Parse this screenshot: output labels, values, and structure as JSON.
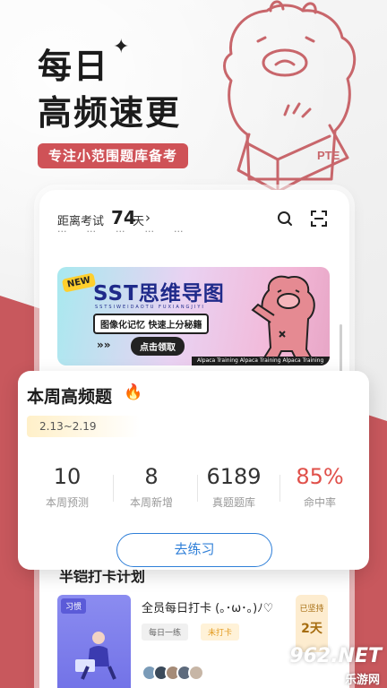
{
  "hero": {
    "line1": "每日",
    "line2": "高频速更",
    "tag": "专注小范围题库备考"
  },
  "mascot": {
    "book_label": "PTE"
  },
  "topbar": {
    "exam_label": "距离考试",
    "days": "74",
    "unit": "天",
    "chevron": "›"
  },
  "menu_strip": [
    "...",
    "...",
    "...",
    "...",
    "..."
  ],
  "banner": {
    "new": "NEW",
    "title": "SST思维导图",
    "pinyin": "SSTSIWEIDAOTU FUXIANGJIYI",
    "subtitle": "图像化记忆  快速上分秘籍",
    "cta": "点击领取",
    "ribbon": "Alpaca Training   Alpaca Training   Alpaca Training"
  },
  "weekly": {
    "title": "本周高频题",
    "date_range": "2.13~2.19",
    "stats": [
      {
        "value": "10",
        "label": "本周预测"
      },
      {
        "value": "8",
        "label": "本周新增"
      },
      {
        "value": "6189",
        "label": "真题题库"
      },
      {
        "value": "85%",
        "label": "命中率"
      }
    ],
    "practice_label": "去练习"
  },
  "plan": {
    "title": "半铠打卡计划",
    "habit_tag": "习惯",
    "name": "全员每日打卡 (｡･ω･｡)ﾉ♡",
    "pill_daily": "每日一练",
    "pill_status": "未打卡",
    "streak_label": "已坚持",
    "streak_value": "2天"
  },
  "watermark": {
    "top": "962.NET",
    "bottom": "乐游网"
  },
  "colors": {
    "accent_red": "#cf5257",
    "practice_blue": "#2f7fd8",
    "hit_rate": "#e0504a"
  }
}
